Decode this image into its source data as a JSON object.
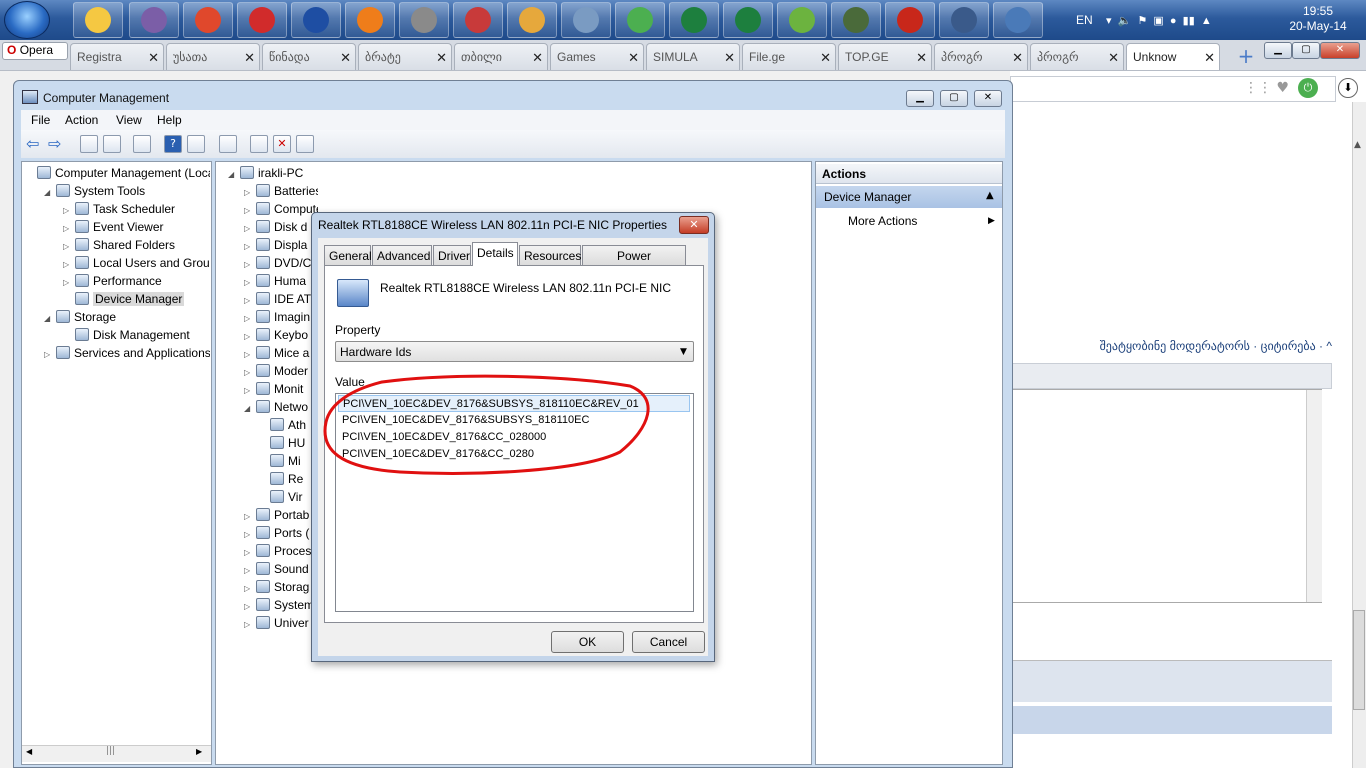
{
  "taskbar": {
    "time": "19:55",
    "date": "20-May-14",
    "language": "EN",
    "apps": [
      "file-explorer-icon",
      "visual-studio-icon",
      "chrome-icon",
      "opera-icon",
      "globe-icon",
      "firefox-icon",
      "tools-icon",
      "pointer-icon",
      "paint-icon",
      "settings-icon",
      "green-icon",
      "excel-icon",
      "excel-icon",
      "utorrent-icon",
      "monitor-icon",
      "pdf-icon",
      "network-icon",
      "computer-icon"
    ]
  },
  "opera": {
    "menu_label": "Opera",
    "tabs": [
      {
        "label": "Registra"
      },
      {
        "label": "უსათა"
      },
      {
        "label": "წინადა"
      },
      {
        "label": "ბრატე"
      },
      {
        "label": "თბილი"
      },
      {
        "label": "Games"
      },
      {
        "label": "SIMULA"
      },
      {
        "label": "File.ge"
      },
      {
        "label": "TOP.GE"
      },
      {
        "label": "პროგრ"
      },
      {
        "label": "პროგრ"
      },
      {
        "label": "Unknow"
      }
    ],
    "page_links": "შეატყობინე მოდერატორს · ციტირება · ^"
  },
  "window": {
    "title": "Computer Management",
    "menu": [
      "File",
      "Action",
      "View",
      "Help"
    ]
  },
  "left_tree": [
    {
      "label": "Computer Management (Local",
      "level": 0
    },
    {
      "label": "System Tools",
      "level": 1
    },
    {
      "label": "Task Scheduler",
      "level": 2
    },
    {
      "label": "Event Viewer",
      "level": 2
    },
    {
      "label": "Shared Folders",
      "level": 2
    },
    {
      "label": "Local Users and Groups",
      "level": 2
    },
    {
      "label": "Performance",
      "level": 2
    },
    {
      "label": "Device Manager",
      "level": 2
    },
    {
      "label": "Storage",
      "level": 1
    },
    {
      "label": "Disk Management",
      "level": 2
    },
    {
      "label": "Services and Applications",
      "level": 1
    }
  ],
  "device_tree": [
    "irakli-PC",
    "Batteries",
    "Computer",
    "Disk d",
    "Displa",
    "DVD/C",
    "Huma",
    "IDE AT",
    "Imagin",
    "Keybo",
    "Mice a",
    "Moder",
    "Monit",
    "Netwo",
    "Ath",
    "HU",
    "Mi",
    "Re",
    "Vir",
    "Portab",
    "Ports (",
    "Proces",
    "Sound",
    "Storag",
    "System",
    "Univer"
  ],
  "actions": {
    "header": "Actions",
    "section": "Device Manager",
    "more": "More Actions"
  },
  "dialog": {
    "title": "Realtek RTL8188CE Wireless LAN 802.11n PCI-E NIC Properties",
    "tabs": [
      "General",
      "Advanced",
      "Driver",
      "Details",
      "Resources",
      "Power Management"
    ],
    "selected_tab": "Details",
    "device_name": "Realtek RTL8188CE Wireless LAN 802.11n PCI-E NIC",
    "property_label": "Property",
    "property_value": "Hardware Ids",
    "value_label": "Value",
    "values": [
      "PCI\\VEN_10EC&DEV_8176&SUBSYS_818110EC&REV_01",
      "PCI\\VEN_10EC&DEV_8176&SUBSYS_818110EC",
      "PCI\\VEN_10EC&DEV_8176&CC_028000",
      "PCI\\VEN_10EC&DEV_8176&CC_0280"
    ],
    "ok": "OK",
    "cancel": "Cancel"
  },
  "annotation_color": "#e01010"
}
